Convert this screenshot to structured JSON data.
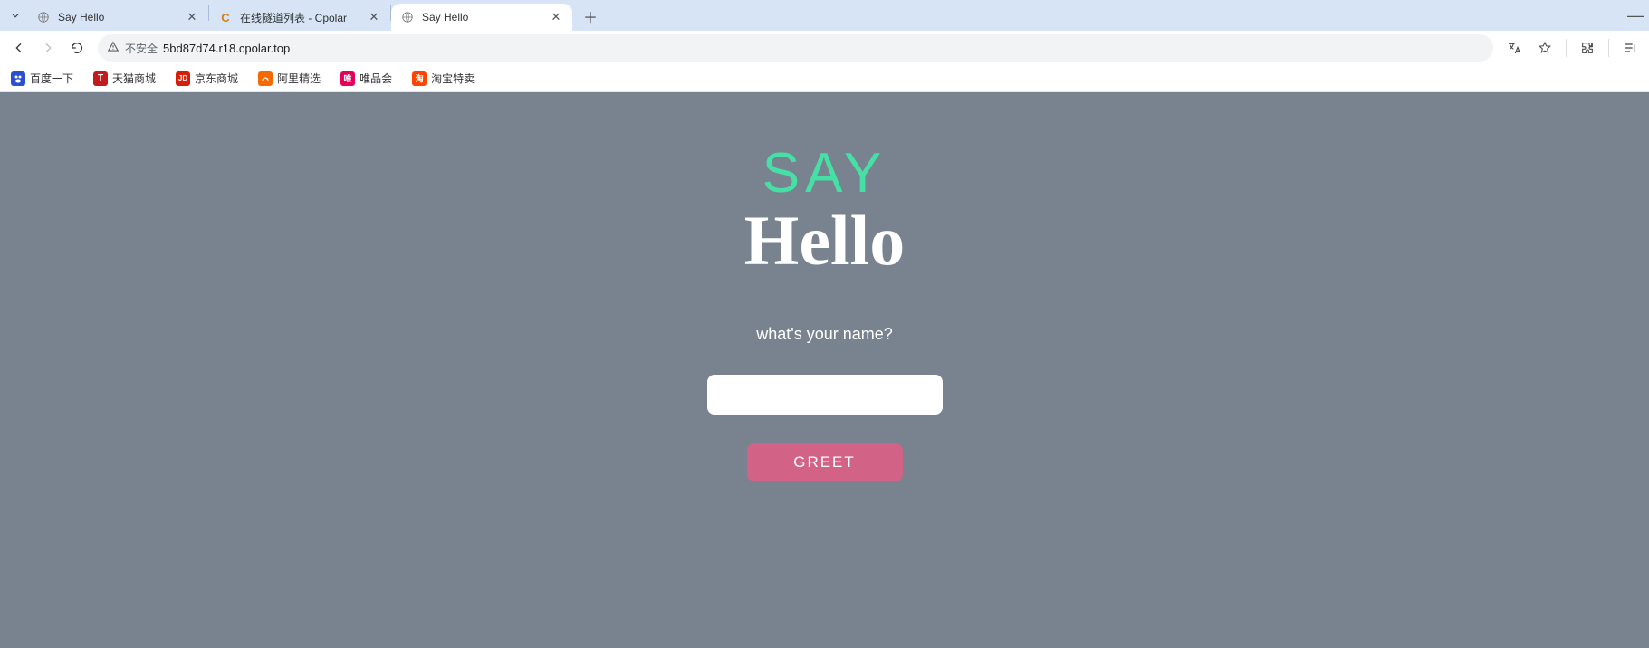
{
  "browser": {
    "tabs": [
      {
        "title": "Say Hello",
        "favicon": "globe",
        "active": false
      },
      {
        "title": "在线隧道列表 - Cpolar",
        "favicon": "cpolar",
        "active": false
      },
      {
        "title": "Say Hello",
        "favicon": "globe",
        "active": true
      }
    ],
    "address_bar": {
      "security_label": "不安全",
      "url": "5bd87d74.r18.cpolar.top"
    },
    "bookmarks": [
      {
        "label": "百度一下",
        "icon_bg": "#2b4fd1",
        "icon_text": ""
      },
      {
        "label": "天猫商城",
        "icon_bg": "#c11b1b",
        "icon_text": "T"
      },
      {
        "label": "京东商城",
        "icon_bg": "#d81e06",
        "icon_text": "JD"
      },
      {
        "label": "阿里精选",
        "icon_bg": "#f56a00",
        "icon_text": ""
      },
      {
        "label": "唯品会",
        "icon_bg": "#e6005a",
        "icon_text": "唯"
      },
      {
        "label": "淘宝特卖",
        "icon_bg": "#ff4400",
        "icon_text": "淘"
      }
    ]
  },
  "page": {
    "heading_top": "SAY",
    "heading_bottom": "Hello",
    "prompt": "what's your name?",
    "name_value": "",
    "button_label": "GREET"
  }
}
